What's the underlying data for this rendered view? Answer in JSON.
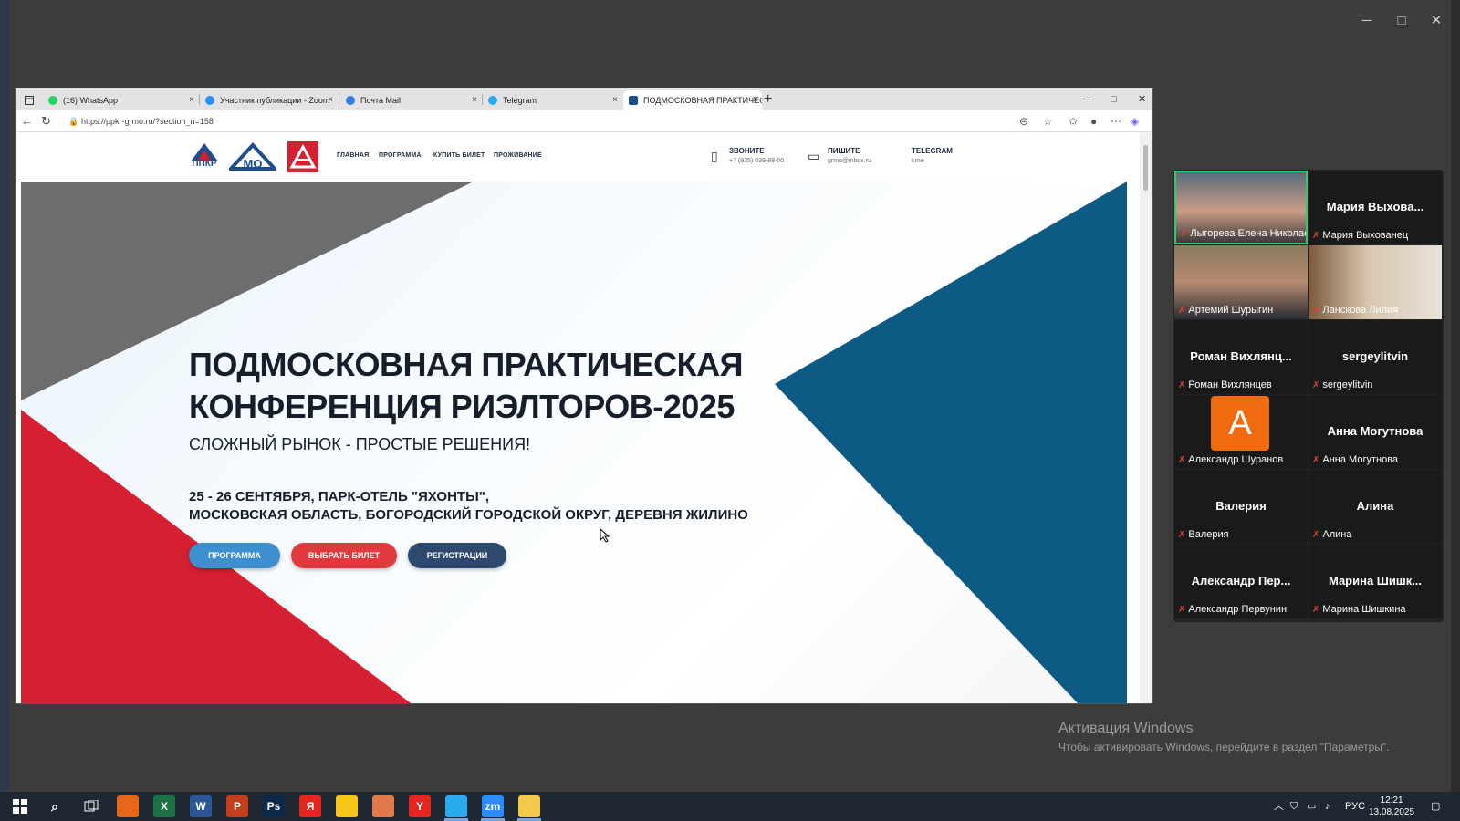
{
  "browser": {
    "tabs": [
      {
        "label": "(16) WhatsApp",
        "favicon_color": "#25d366"
      },
      {
        "label": "Участник публикации - Zoom",
        "favicon_color": "#2d8cff"
      },
      {
        "label": "Почта Mail",
        "favicon_color": "#3a7be0"
      },
      {
        "label": "Telegram",
        "favicon_color": "#2aabee"
      },
      {
        "label": "ПОДМОСКОВНАЯ ПРАКТИЧЕСК",
        "favicon_color": "#1d4e89"
      }
    ],
    "close_glyph": "×",
    "new_tab": "+",
    "url": "https://ppkr-grmo.ru/?section_n=158"
  },
  "site": {
    "logos": [
      "ППКР",
      "МО"
    ],
    "menu": [
      "ГЛАВНАЯ",
      "ПРОГРАММА",
      "КУПИТЬ БИЛЕТ",
      "ПРОЖИВАНИЕ"
    ],
    "contacts": [
      {
        "title": "ЗВОНИТЕ",
        "sub": "+7 (925) 039-88-00"
      },
      {
        "title": "ПИШИТЕ",
        "sub": "grmo@inbox.ru"
      },
      {
        "title": "TELEGRAM",
        "sub": "t.me"
      }
    ],
    "hero": {
      "title_line1": "ПОДМОСКОВНАЯ ПРАКТИЧЕСКАЯ",
      "title_line2": "КОНФЕРЕНЦИЯ РИЭЛТОРОВ-2025",
      "subtitle": "СЛОЖНЫЙ РЫНОК - ПРОСТЫЕ РЕШЕНИЯ!",
      "date_bold": "25 - 26 СЕНТЯБРЯ,",
      "date_place": " ПАРК-ОТЕЛЬ \"ЯХОНТЫ\",",
      "address": "МОСКОВСКАЯ ОБЛАСТЬ, БОГОРОДСКИЙ ГОРОДСКОЙ ОКРУГ, ДЕРЕВНЯ ЖИЛИНО",
      "buttons": [
        {
          "label": "ПРОГРАММА",
          "color": "#3d8fd0"
        },
        {
          "label": "ВЫБРАТЬ БИЛЕТ",
          "color": "#e0393e"
        },
        {
          "label": "РЕГИСТРАЦИИ",
          "color": "#2d4a6e"
        }
      ]
    },
    "colors": {
      "red": "#d42030",
      "blue": "#0d5a85",
      "gray": "#6d6d6d"
    }
  },
  "participants": [
    {
      "display": "",
      "label": "Лыгорева Елена Николае...",
      "video": true,
      "speaking": true
    },
    {
      "display": "Мария Выхова...",
      "label": "Мария Выхованец",
      "video": false
    },
    {
      "display": "",
      "label": "Артемий Шурыгин",
      "video": true
    },
    {
      "display": "",
      "label": "Ланскова Лилия",
      "video": true
    },
    {
      "display": "Роман Вихлянц...",
      "label": "Роман Вихлянцев",
      "video": false
    },
    {
      "display": "sergeylitvin",
      "label": "sergeylitvin",
      "video": false
    },
    {
      "display": "",
      "label": "Александр Шуранов",
      "video": false,
      "avatar": "A"
    },
    {
      "display": "Анна Могутнова",
      "label": "Анна Могутнова",
      "video": false
    },
    {
      "display": "Валерия",
      "label": "Валерия",
      "video": false
    },
    {
      "display": "Алина",
      "label": "Алина",
      "video": false
    },
    {
      "display": "Александр Пер...",
      "label": "Александр Первунин",
      "video": false
    },
    {
      "display": "Марина Шишк...",
      "label": "Марина Шишкина",
      "video": false
    }
  ],
  "watermark": {
    "line1": "Активация Windows",
    "line2": "Чтобы активировать Windows, перейдите в раздел \"Параметры\"."
  },
  "taskbar": {
    "apps": [
      {
        "name": "firefox-icon",
        "glyph": "",
        "color": "#e8661a"
      },
      {
        "name": "excel-icon",
        "glyph": "X",
        "color": "#1d7044"
      },
      {
        "name": "word-icon",
        "glyph": "W",
        "color": "#2b5797"
      },
      {
        "name": "powerpoint-icon",
        "glyph": "P",
        "color": "#c43e1c"
      },
      {
        "name": "photoshop-icon",
        "glyph": "Ps",
        "color": "#0b2a4a"
      },
      {
        "name": "yandex-icon",
        "glyph": "Я",
        "color": "#e52620"
      },
      {
        "name": "yandex-music-icon",
        "glyph": "",
        "color": "#f5c518"
      },
      {
        "name": "store-icon",
        "glyph": "",
        "color": "#e07a4a"
      },
      {
        "name": "yandex-browser-icon",
        "glyph": "Y",
        "color": "#e52620"
      },
      {
        "name": "telegram-icon",
        "glyph": "",
        "color": "#2aabee"
      },
      {
        "name": "zoom-icon",
        "glyph": "zm",
        "color": "#2d8cff"
      },
      {
        "name": "file-explorer-icon",
        "glyph": "",
        "color": "#f2c94c"
      }
    ],
    "lang": "РУС",
    "time": "12:21",
    "date": "13.08.2025"
  }
}
